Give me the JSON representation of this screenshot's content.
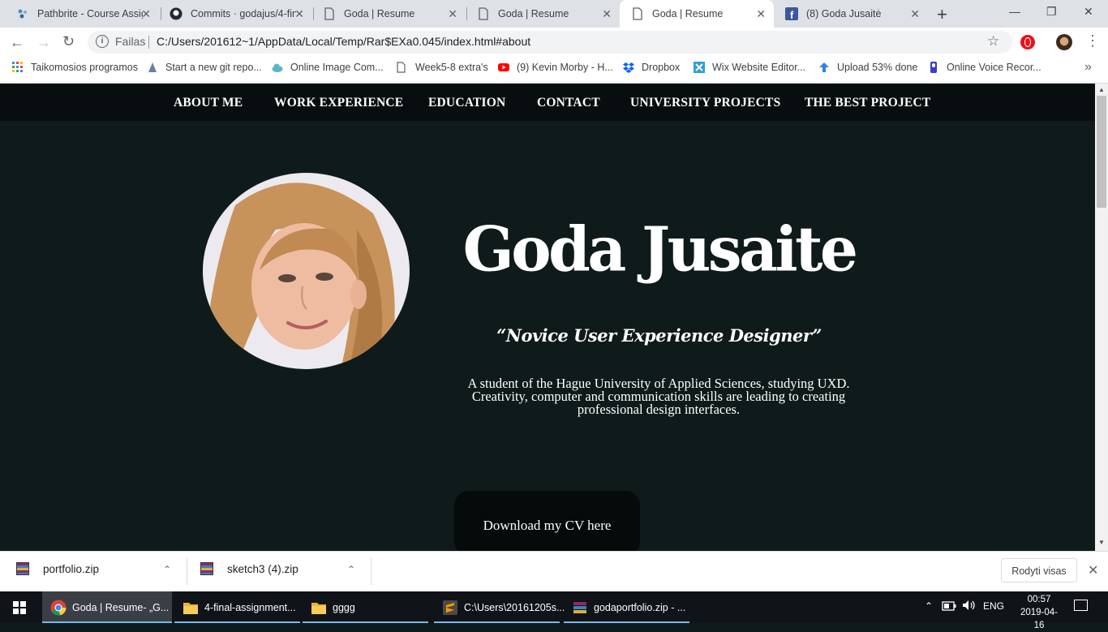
{
  "browser": {
    "tabs": [
      {
        "title": "Pathbrite - Course Assig",
        "close": "✕"
      },
      {
        "title": "Commits · godajus/4-fin",
        "close": "✕"
      },
      {
        "title": "Goda | Resume",
        "close": "✕"
      },
      {
        "title": "Goda | Resume",
        "close": "✕"
      },
      {
        "title": "Goda | Resume",
        "close": "✕"
      },
      {
        "title": "(8) Goda Jusaitė",
        "close": "✕"
      }
    ],
    "active_tab": 4,
    "new_tab": "+",
    "window_controls": {
      "minimize": "—",
      "maximize": "❐",
      "close": "✕"
    },
    "nav": {
      "back": "←",
      "forward": "→",
      "reload": "↻"
    },
    "address": {
      "scheme_label": "Failas",
      "url": "C:/Users/201612~1/AppData/Local/Temp/Rar$EXa0.045/index.html#about",
      "info": "i"
    },
    "star": "☆",
    "menu": "⋮",
    "bookmarks": [
      {
        "label": "Taikomosios programos",
        "icon": "apps-grid-icon"
      },
      {
        "label": "Start a new git repo...",
        "icon": "git-icon"
      },
      {
        "label": "Online Image Com...",
        "icon": "cloud-icon"
      },
      {
        "label": "Week5-8 extra's",
        "icon": "page-icon"
      },
      {
        "label": "(9) Kevin Morby - H...",
        "icon": "youtube-icon"
      },
      {
        "label": "Dropbox",
        "icon": "dropbox-icon"
      },
      {
        "label": "Wix Website Editor...",
        "icon": "wix-icon"
      },
      {
        "label": "Upload 53% done",
        "icon": "upload-icon"
      },
      {
        "label": "Online Voice Recor...",
        "icon": "mic-icon"
      }
    ],
    "bookmarks_more": "»"
  },
  "site": {
    "nav": [
      "ABOUT ME",
      "WORK EXPERIENCE",
      "EDUCATION",
      "CONTACT",
      "UNIVERSITY PROJECTS",
      "THE BEST PROJECT"
    ],
    "name": "Goda Jusaite",
    "role": "“Novice User Experience Designer”",
    "bio": "A student of the Hague University of Applied Sciences, studying UXD. Creativity, computer and communication skills are leading to creating professional design interfaces.",
    "cv_button": "Download my CV here",
    "colors": {
      "background": "#0f1a1b",
      "nav": "#080e0f",
      "button": "#050a0b",
      "text": "#ffffff"
    }
  },
  "downloads": {
    "items": [
      {
        "name": "portfolio.zip",
        "chevron": "⌃"
      },
      {
        "name": "sketch3 (4).zip",
        "chevron": "⌃"
      }
    ],
    "show_all": "Rodyti visas",
    "close": "✕"
  },
  "taskbar": {
    "items": [
      {
        "label": "Goda | Resume- „G...",
        "icon": "chrome-icon"
      },
      {
        "label": "4-final-assignment...",
        "icon": "folder-icon"
      },
      {
        "label": "gggg",
        "icon": "folder-icon"
      },
      {
        "label": "C:\\Users\\20161205s...",
        "icon": "sublime-icon"
      },
      {
        "label": "godaportfolio.zip - ...",
        "icon": "winrar-icon"
      }
    ],
    "tray": {
      "chevron": "⌃",
      "lang": "ENG"
    },
    "clock": {
      "time": "00:57",
      "date": "2019-04-16"
    }
  }
}
